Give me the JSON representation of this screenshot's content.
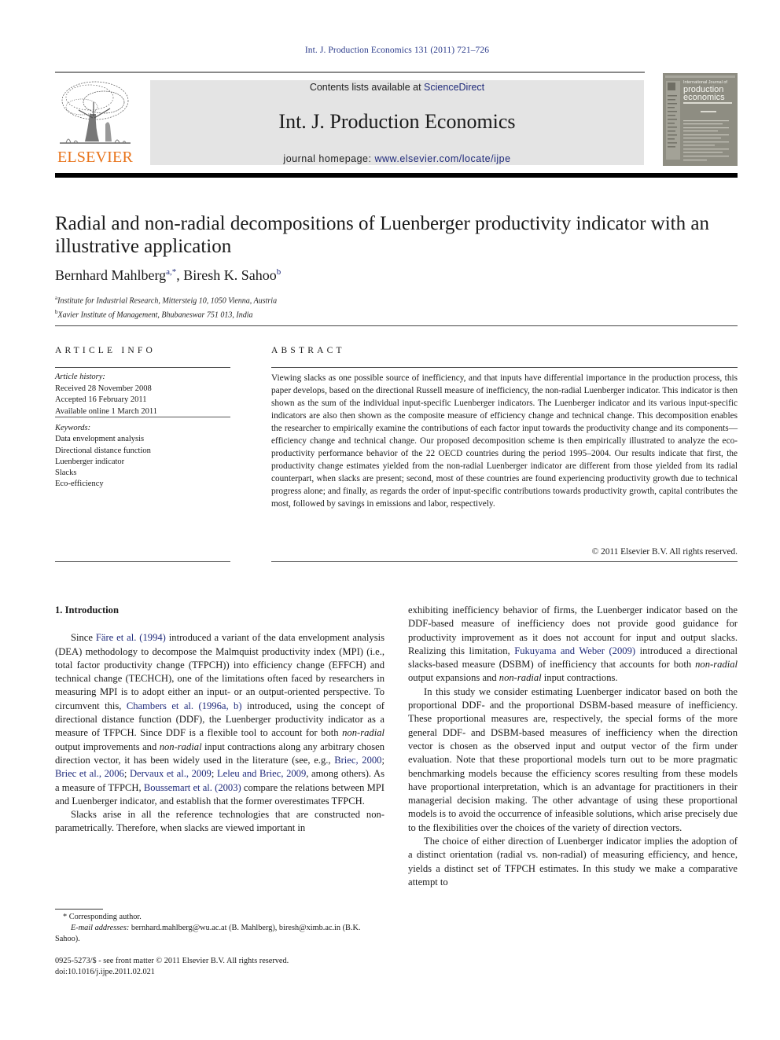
{
  "header": {
    "journal_ref": "Int. J. Production Economics 131 (2011) 721–726",
    "publisher_wordmark": "ELSEVIER",
    "contents_prefix": "Contents lists available at ",
    "contents_link": "ScienceDirect",
    "journal_title": "Int. J. Production Economics",
    "homepage_prefix": "journal homepage: ",
    "homepage_link": "www.elsevier.com/locate/ijpe",
    "cover": {
      "line1": "International Journal of",
      "line2": "production",
      "line3": "economics"
    },
    "colors": {
      "elsevier_orange": "#e8731a",
      "link_blue": "#1f2a7a",
      "masthead_gray": "#e4e4e4"
    }
  },
  "article": {
    "title": "Radial and non-radial decompositions of Luenberger productivity indicator with an illustrative application",
    "authors": [
      {
        "name": "Bernhard Mahlberg",
        "sup": "a,*"
      },
      {
        "name": "Biresh K. Sahoo",
        "sup": "b"
      }
    ],
    "affiliations": [
      {
        "sup": "a",
        "text": "Institute for Industrial Research, Mittersteig 10, 1050 Vienna, Austria"
      },
      {
        "sup": "b",
        "text": "Xavier Institute of Management, Bhubaneswar 751 013, India"
      }
    ]
  },
  "article_info": {
    "heading": "ARTICLE INFO",
    "history_label": "Article history:",
    "received": "Received 28 November 2008",
    "accepted": "Accepted 16 February 2011",
    "online": "Available online 1 March 2011",
    "keywords_label": "Keywords:",
    "keywords": [
      "Data envelopment analysis",
      "Directional distance function",
      "Luenberger indicator",
      "Slacks",
      "Eco-efficiency"
    ]
  },
  "abstract": {
    "heading": "ABSTRACT",
    "text": "Viewing slacks as one possible source of inefficiency, and that inputs have differential importance in the production process, this paper develops, based on the directional Russell measure of inefficiency, the non-radial Luenberger indicator. This indicator is then shown as the sum of the individual input-specific Luenberger indicators. The Luenberger indicator and its various input-specific indicators are also then shown as the composite measure of efficiency change and technical change. This decomposition enables the researcher to empirically examine the contributions of each factor input towards the productivity change and its components—efficiency change and technical change. Our proposed decomposition scheme is then empirically illustrated to analyze the eco-productivity performance behavior of the 22 OECD countries during the period 1995–2004. Our results indicate that first, the productivity change estimates yielded from the non-radial Luenberger indicator are different from those yielded from its radial counterpart, when slacks are present; second, most of these countries are found experiencing productivity growth due to technical progress alone; and finally, as regards the order of input-specific contributions towards productivity growth, capital contributes the most, followed by savings in emissions and labor, respectively.",
    "copyright": "© 2011 Elsevier B.V. All rights reserved."
  },
  "body": {
    "section_heading": "1.  Introduction",
    "left": {
      "p1": [
        {
          "t": "Since "
        },
        {
          "t": "Färe et al. (1994)",
          "link": true
        },
        {
          "t": " introduced a variant of the data envelopment analysis (DEA) methodology to decompose the Malmquist productivity index (MPI) (i.e., total factor productivity change (TFPCH)) into efficiency change (EFFCH) and technical change (TECHCH), one of the limitations often faced by researchers in measuring MPI is to adopt either an input- or an output-oriented perspective. To circumvent this, "
        },
        {
          "t": "Chambers et al. (1996a, b)",
          "link": true
        },
        {
          "t": " introduced, using the concept of directional distance function (DDF), the Luenberger productivity indicator as a measure of TFPCH. Since DDF is a flexible tool to account for both "
        },
        {
          "t": "non-radial",
          "ital": true
        },
        {
          "t": " output improvements and "
        },
        {
          "t": "non-radial",
          "ital": true
        },
        {
          "t": " input contractions along any arbitrary chosen direction vector, it has been widely used in the literature (see, e.g., "
        },
        {
          "t": "Briec, 2000",
          "link": true
        },
        {
          "t": "; "
        },
        {
          "t": "Briec et al., 2006",
          "link": true
        },
        {
          "t": "; "
        },
        {
          "t": "Dervaux et al., 2009",
          "link": true
        },
        {
          "t": "; "
        },
        {
          "t": "Leleu and Briec, 2009",
          "link": true
        },
        {
          "t": ", among others). As a measure of TFPCH, "
        },
        {
          "t": "Boussemart et al. (2003)",
          "link": true
        },
        {
          "t": " compare the relations between MPI and Luenberger indicator, and establish that the former overestimates TFPCH."
        }
      ],
      "p2": "Slacks arise in all the reference technologies that are constructed non-parametrically. Therefore, when slacks are viewed important in"
    },
    "right": {
      "p1": [
        {
          "t": "exhibiting inefficiency behavior of firms, the Luenberger indicator based on the DDF-based measure of inefficiency does not provide good guidance for productivity improvement as it does not account for input and output slacks. Realizing this limitation, "
        },
        {
          "t": "Fukuyama and Weber (2009)",
          "link": true
        },
        {
          "t": " introduced a directional slacks-based measure (DSBM) of inefficiency that accounts for both "
        },
        {
          "t": "non-radial",
          "ital": true
        },
        {
          "t": " output expansions and "
        },
        {
          "t": "non-radial",
          "ital": true
        },
        {
          "t": " input contractions."
        }
      ],
      "p2": "In this study we consider estimating Luenberger indicator based on both the proportional DDF- and the proportional DSBM-based measure of inefficiency. These proportional measures are, respectively, the special forms of the more general DDF- and DSBM-based measures of inefficiency when the direction vector is chosen as the observed input and output vector of the firm under evaluation. Note that these proportional models turn out to be more pragmatic benchmarking models because the efficiency scores resulting from these models have proportional interpretation, which is an advantage for practitioners in their managerial decision making. The other advantage of using these proportional models is to avoid the occurrence of infeasible solutions, which arise precisely due to the flexibilities over the choices of the variety of direction vectors.",
      "p3": "The choice of either direction of Luenberger indicator implies the adoption of a distinct orientation (radial vs. non-radial) of measuring efficiency, and hence, yields a distinct set of TFPCH estimates. In this study we make a comparative attempt to"
    }
  },
  "footnotes": {
    "corresponding": "* Corresponding author.",
    "email_label": "E-mail addresses:",
    "email_text": " bernhard.mahlberg@wu.ac.at (B. Mahlberg), biresh@ximb.ac.in (B.K. Sahoo).",
    "issn_line": "0925-5273/$ - see front matter © 2011 Elsevier B.V. All rights reserved.",
    "doi_line": "doi:10.1016/j.ijpe.2011.02.021"
  }
}
